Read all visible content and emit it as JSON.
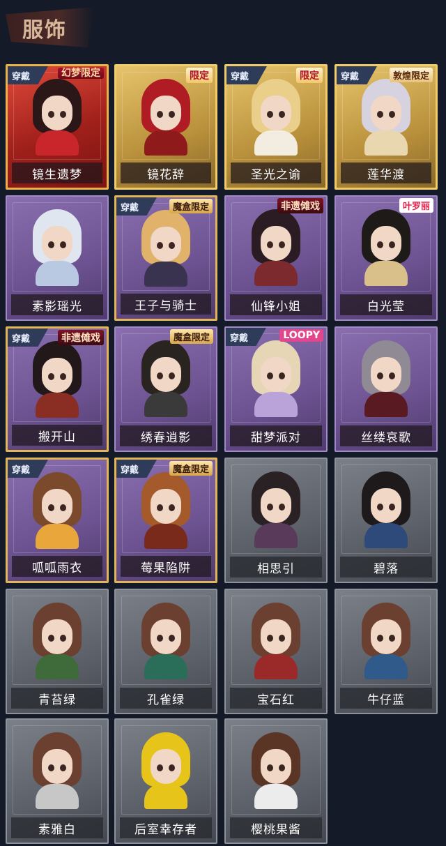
{
  "section_title": "服饰",
  "worn_label": "穿戴",
  "cards": [
    {
      "name": "镜生遗梦",
      "theme": "red",
      "worn": true,
      "badge": "幻梦限定",
      "badge_type": "dream",
      "hair": "#2b1618",
      "body": "#c8262a"
    },
    {
      "name": "镜花辞",
      "theme": "gold",
      "worn": false,
      "badge": "限定",
      "badge_type": "limit",
      "hair": "#b01c24",
      "body": "#8e1a1c"
    },
    {
      "name": "圣光之谕",
      "theme": "gold",
      "worn": true,
      "badge": "限定",
      "badge_type": "limit",
      "hair": "#e9cf8a",
      "body": "#f3ece0"
    },
    {
      "name": "莲华渡",
      "theme": "gold",
      "worn": true,
      "badge": "敦煌限定",
      "badge_type": "dunhuang",
      "hair": "#d7d2df",
      "body": "#e9d7b0"
    },
    {
      "name": "素影瑶光",
      "theme": "purple",
      "worn": false,
      "badge": "",
      "badge_type": "",
      "hair": "#dfe6ef",
      "body": "#b9c9e2"
    },
    {
      "name": "王子与骑士",
      "theme": "purple-gold",
      "worn": true,
      "badge": "魔盒限定",
      "badge_type": "box",
      "hair": "#e0b26a",
      "body": "#3a3350"
    },
    {
      "name": "仙锋小姐",
      "theme": "purple",
      "worn": false,
      "badge": "非遗傩戏",
      "badge_type": "heritage",
      "hair": "#2a1c22",
      "body": "#7d2a2e"
    },
    {
      "name": "白光莹",
      "theme": "purple",
      "worn": false,
      "badge": "叶罗丽",
      "badge_type": "brand",
      "hair": "#1e1a18",
      "body": "#d9c08a"
    },
    {
      "name": "搬开山",
      "theme": "purple-gold",
      "worn": true,
      "badge": "非遗傩戏",
      "badge_type": "heritage",
      "hair": "#22181a",
      "body": "#8a2e24"
    },
    {
      "name": "绣春逍影",
      "theme": "purple",
      "worn": false,
      "badge": "魔盒限定",
      "badge_type": "box",
      "hair": "#2a2420",
      "body": "#3a3a3a"
    },
    {
      "name": "甜梦派对",
      "theme": "purple",
      "worn": true,
      "badge": "LOOPY",
      "badge_type": "loopy",
      "hair": "#e6d6b6",
      "body": "#b9a3d9"
    },
    {
      "name": "丝缕哀歌",
      "theme": "purple",
      "worn": false,
      "badge": "",
      "badge_type": "",
      "hair": "#8f8a94",
      "body": "#5a1a22"
    },
    {
      "name": "呱呱雨衣",
      "theme": "purple-gold",
      "worn": true,
      "badge": "",
      "badge_type": "",
      "hair": "#7b4a2c",
      "body": "#e9a63a"
    },
    {
      "name": "莓果陷阱",
      "theme": "purple-gold",
      "worn": true,
      "badge": "魔盒限定",
      "badge_type": "box",
      "hair": "#a45a2a",
      "body": "#7a2a1a"
    },
    {
      "name": "相思引",
      "theme": "gray",
      "worn": false,
      "badge": "",
      "badge_type": "",
      "hair": "#2a2124",
      "body": "#5a3a5a"
    },
    {
      "name": "碧落",
      "theme": "gray",
      "worn": false,
      "badge": "",
      "badge_type": "",
      "hair": "#1e1a1c",
      "body": "#2d4a7a"
    },
    {
      "name": "青苔绿",
      "theme": "gray",
      "worn": false,
      "badge": "",
      "badge_type": "",
      "hair": "#6b4030",
      "body": "#3f6a3a"
    },
    {
      "name": "孔雀绿",
      "theme": "gray",
      "worn": false,
      "badge": "",
      "badge_type": "",
      "hair": "#6b4030",
      "body": "#2a6e5a"
    },
    {
      "name": "宝石红",
      "theme": "gray",
      "worn": false,
      "badge": "",
      "badge_type": "",
      "hair": "#6b4030",
      "body": "#9a2a2a"
    },
    {
      "name": "牛仔蓝",
      "theme": "gray",
      "worn": false,
      "badge": "",
      "badge_type": "",
      "hair": "#6b4030",
      "body": "#2f5a8a"
    },
    {
      "name": "素雅白",
      "theme": "gray",
      "worn": false,
      "badge": "",
      "badge_type": "",
      "hair": "#6b4030",
      "body": "#c7c7c7"
    },
    {
      "name": "后室幸存者",
      "theme": "gray",
      "worn": false,
      "badge": "",
      "badge_type": "",
      "hair": "#e7c41a",
      "body": "#e7c41a"
    },
    {
      "name": "樱桃果酱",
      "theme": "gray",
      "worn": false,
      "badge": "",
      "badge_type": "",
      "hair": "#5a3424",
      "body": "#ececec"
    }
  ]
}
